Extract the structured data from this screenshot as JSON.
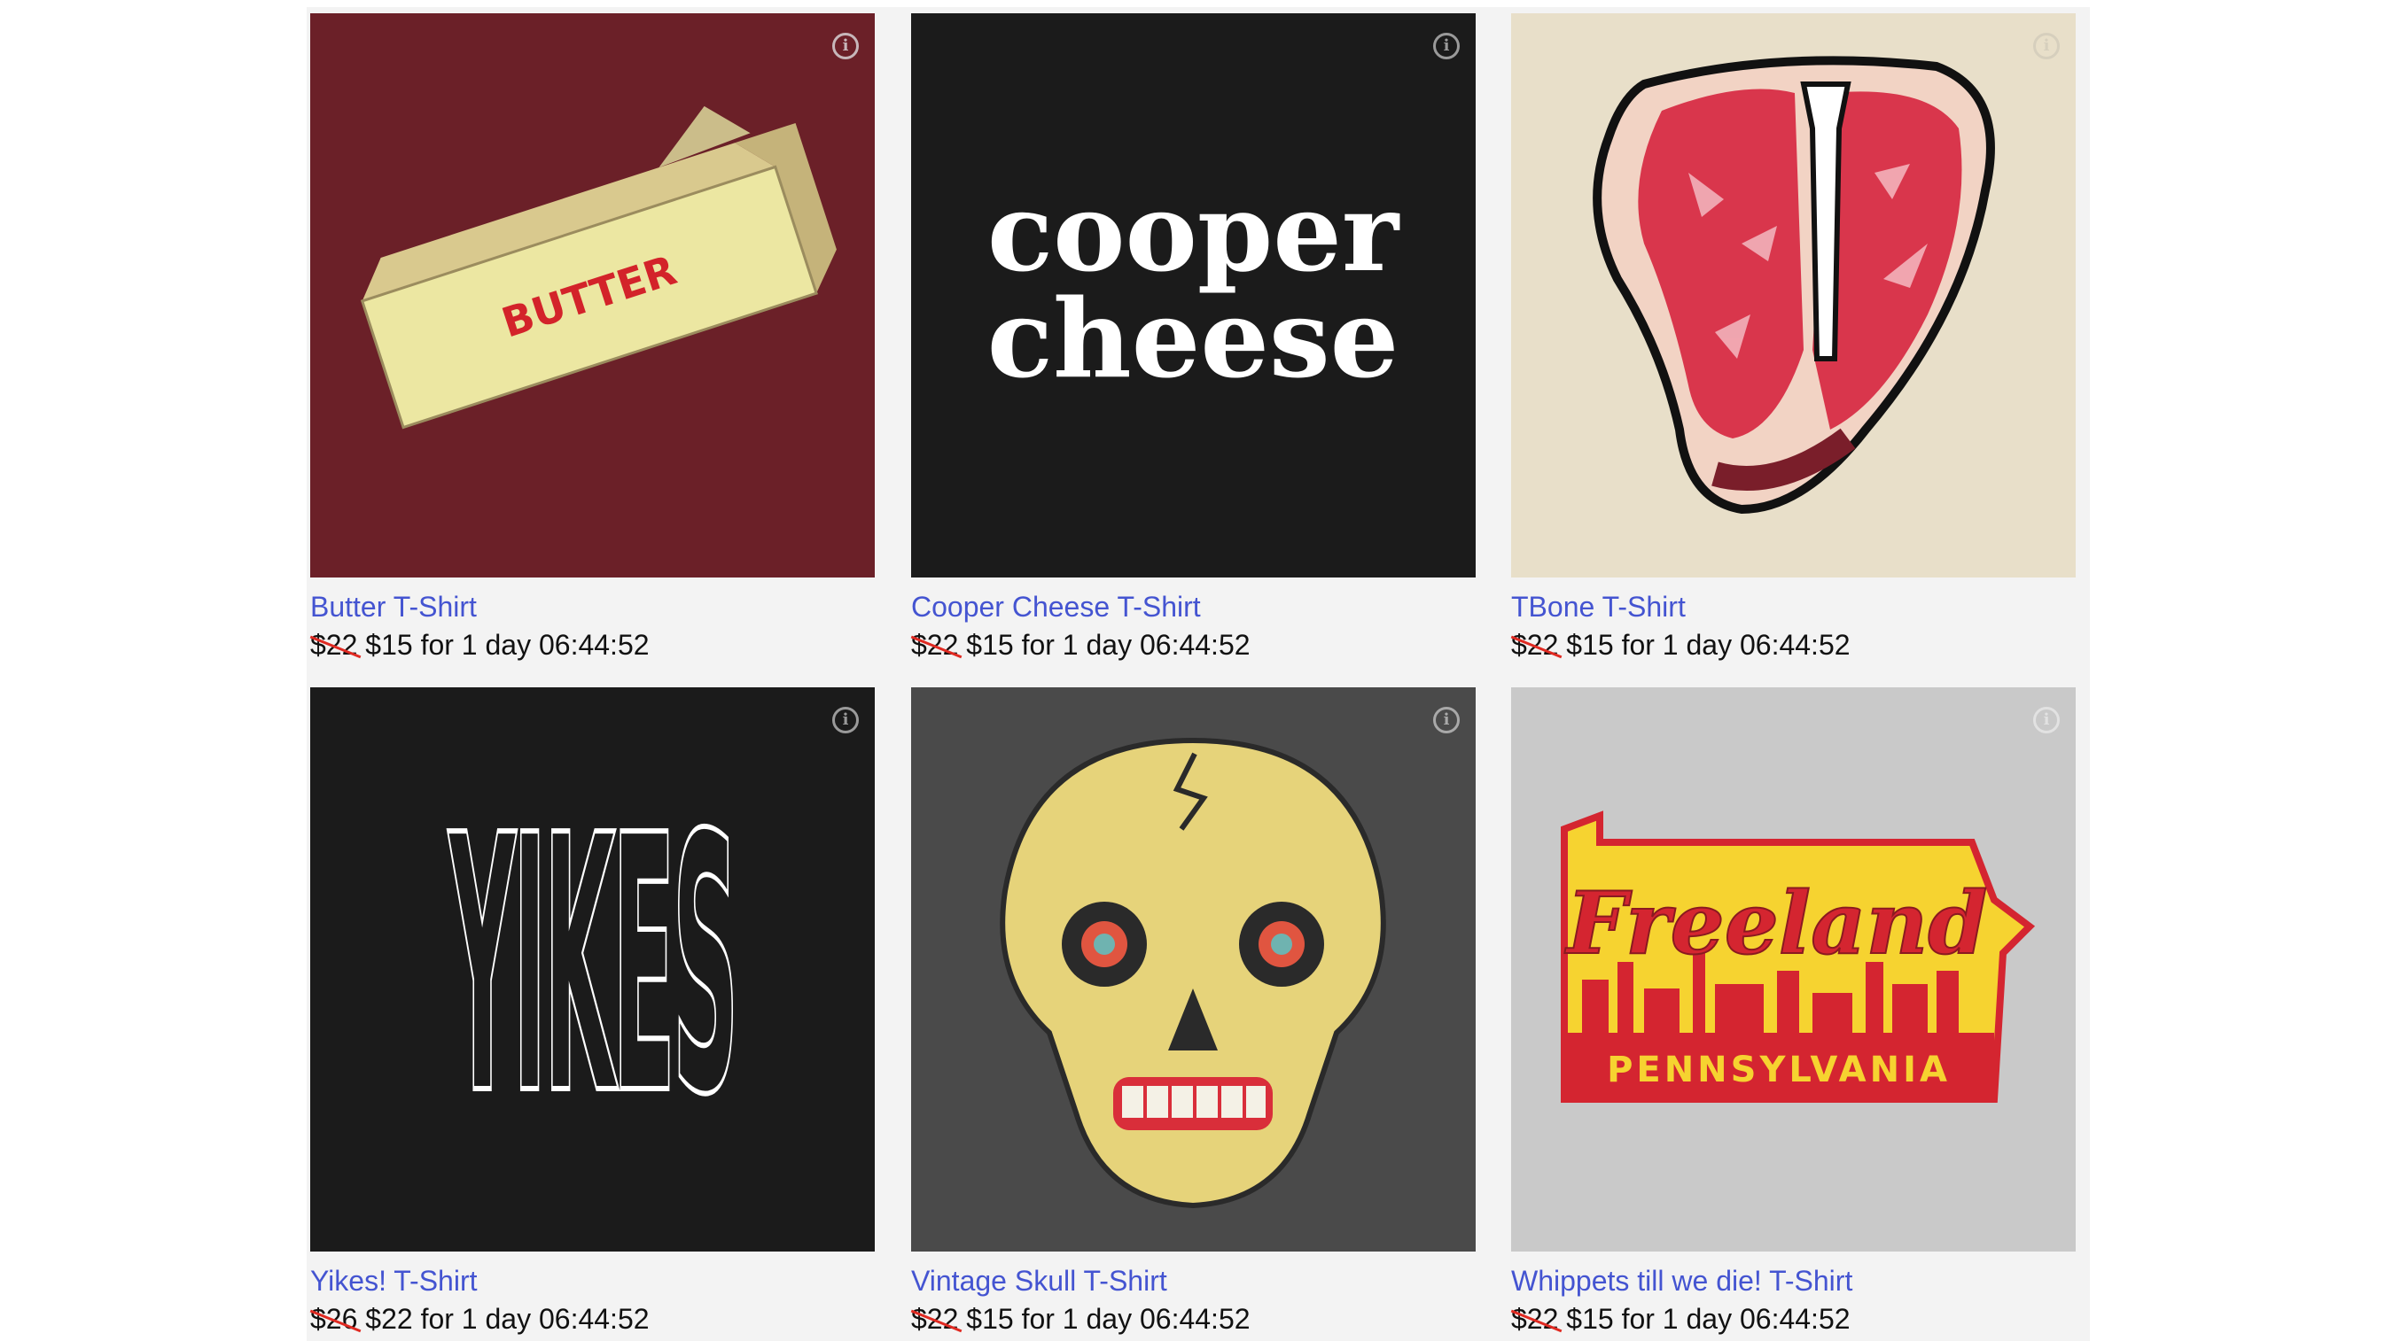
{
  "products": [
    {
      "title": "Butter T-Shirt",
      "old_price": "$22",
      "new_price": "$15",
      "countdown": "for 1 day 06:44:52",
      "bg": "#6b2028",
      "info_icon": "info-icon"
    },
    {
      "title": "Cooper Cheese T-Shirt",
      "old_price": "$22",
      "new_price": "$15",
      "countdown": "for 1 day 06:44:52",
      "bg": "#1b1b1b",
      "art_text_1": "cooper",
      "art_text_2": "cheese",
      "info_icon": "info-icon"
    },
    {
      "title": "TBone T-Shirt",
      "old_price": "$22",
      "new_price": "$15",
      "countdown": "for 1 day 06:44:52",
      "bg": "#e8dfc9",
      "info_icon": "info-icon"
    },
    {
      "title": "Yikes! T-Shirt",
      "old_price": "$26",
      "new_price": "$22",
      "countdown": "for 1 day 06:44:52",
      "bg": "#1b1b1b",
      "info_icon": "info-icon"
    },
    {
      "title": "Vintage Skull T-Shirt",
      "old_price": "$22",
      "new_price": "$15",
      "countdown": "for 1 day 06:44:52",
      "bg": "#4a4a4a",
      "info_icon": "info-icon"
    },
    {
      "title": "Whippets till we die! T-Shirt",
      "old_price": "$22",
      "new_price": "$15",
      "countdown": "for 1 day 06:44:52",
      "bg": "#c9c9c9",
      "info_icon": "info-icon"
    }
  ],
  "colors": {
    "link": "#4454d1",
    "strike": "#e02a22",
    "panel": "#f3f3f3"
  }
}
